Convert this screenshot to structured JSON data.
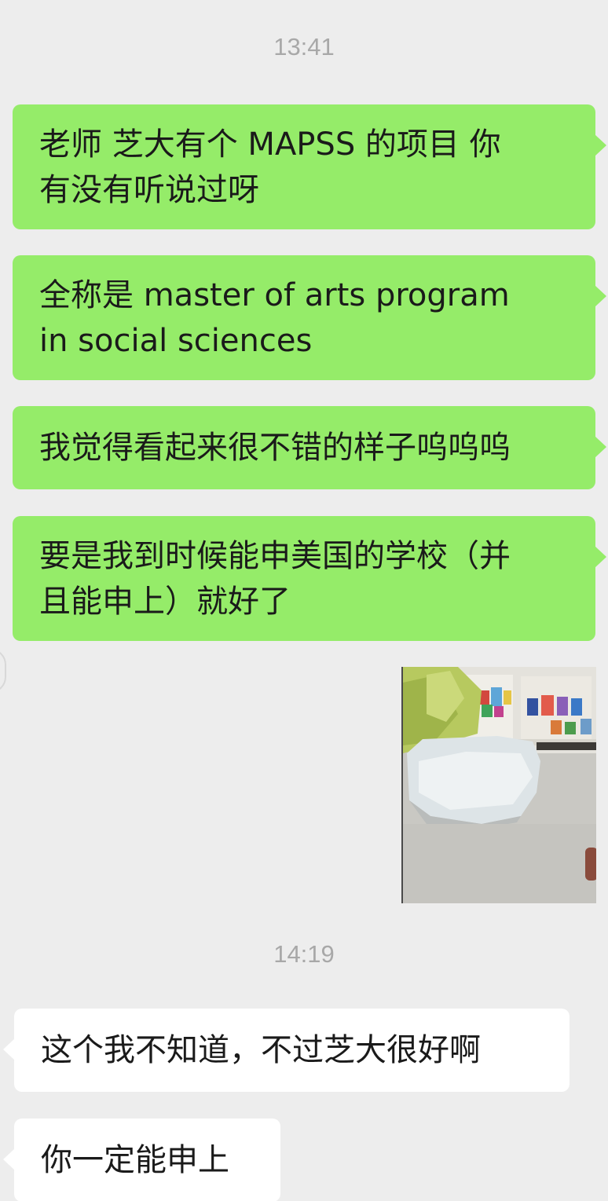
{
  "messages": {
    "ts1": "13:41",
    "m1_line1": "老师 芝大有个 MAPSS 的项目 你",
    "m1_line2": "有没有听说过呀",
    "m2_line1": "全称是 master of arts program",
    "m2_line2": "in social sciences",
    "m3_line1": "我觉得看起来很不错的样子呜呜呜",
    "m4_line1": "要是我到时候能申美国的学校（并",
    "m4_line2": "且能申上）就好了",
    "ts2": "14:19",
    "r1_line1": "这个我不知道，不过芝大很好啊",
    "r2_line1": "你一定能申上"
  },
  "photo": {
    "icon": "photo-thumbnail-icon",
    "colors": {
      "wall": "#cfcec9",
      "shelf": "#e8e6df",
      "bag": "#dde4e7",
      "plant": "#b7c95f"
    }
  },
  "colors": {
    "background": "#ededed",
    "outgoing_bubble": "#95ec69",
    "incoming_bubble": "#ffffff",
    "timestamp": "#a8a8a8"
  }
}
